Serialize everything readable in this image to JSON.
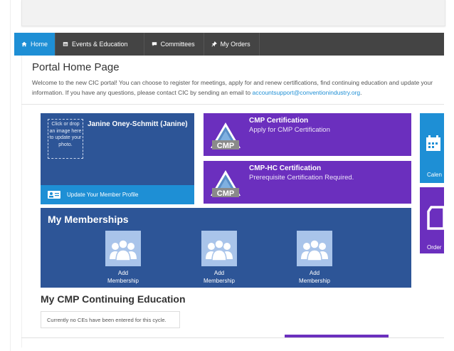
{
  "nav": {
    "items": [
      {
        "label": "Home",
        "icon": "home-icon"
      },
      {
        "label": "Events & Education",
        "icon": "calendar-list-icon"
      },
      {
        "label": "Committees",
        "icon": "chat-bubble-icon"
      },
      {
        "label": "My Orders",
        "icon": "pin-icon"
      }
    ]
  },
  "page": {
    "title": "Portal Home Page",
    "intro": "Welcome to the new CIC portal! You can choose to register for meetings, apply for and renew certifications, find continuing education and update your information. If you have any questions, please contact CIC by sending an email to ",
    "email": "accountsupport@conventionindustry.org",
    "intro_end": "."
  },
  "profile": {
    "photo_hint": "Click or drop an image here to update your photo.",
    "name": "Janine Oney-Schmitt (Janine)",
    "update_label": "Update Your Member Profile"
  },
  "certs": [
    {
      "title": "CMP Certification",
      "subtitle": "Apply for CMP Certification",
      "logo": "CMP"
    },
    {
      "title": "CMP-HC Certification",
      "subtitle": "Prerequisite Certification Required.",
      "logo": "CMP"
    }
  ],
  "tiles": {
    "calendar_label": "Calen",
    "orders_label": "Order"
  },
  "memberships": {
    "title": "My Memberships",
    "items": [
      {
        "label": "Add\nMembership"
      },
      {
        "label": "Add\nMembership"
      },
      {
        "label": "Add\nMembership"
      }
    ]
  },
  "ce": {
    "title": "My CMP Continuing Education",
    "empty_text": "Currently no CEs have been entered for this cycle."
  },
  "colors": {
    "nav_active": "#1e8fd5",
    "navy": "#2d5597",
    "purple": "#6b2fbe"
  }
}
